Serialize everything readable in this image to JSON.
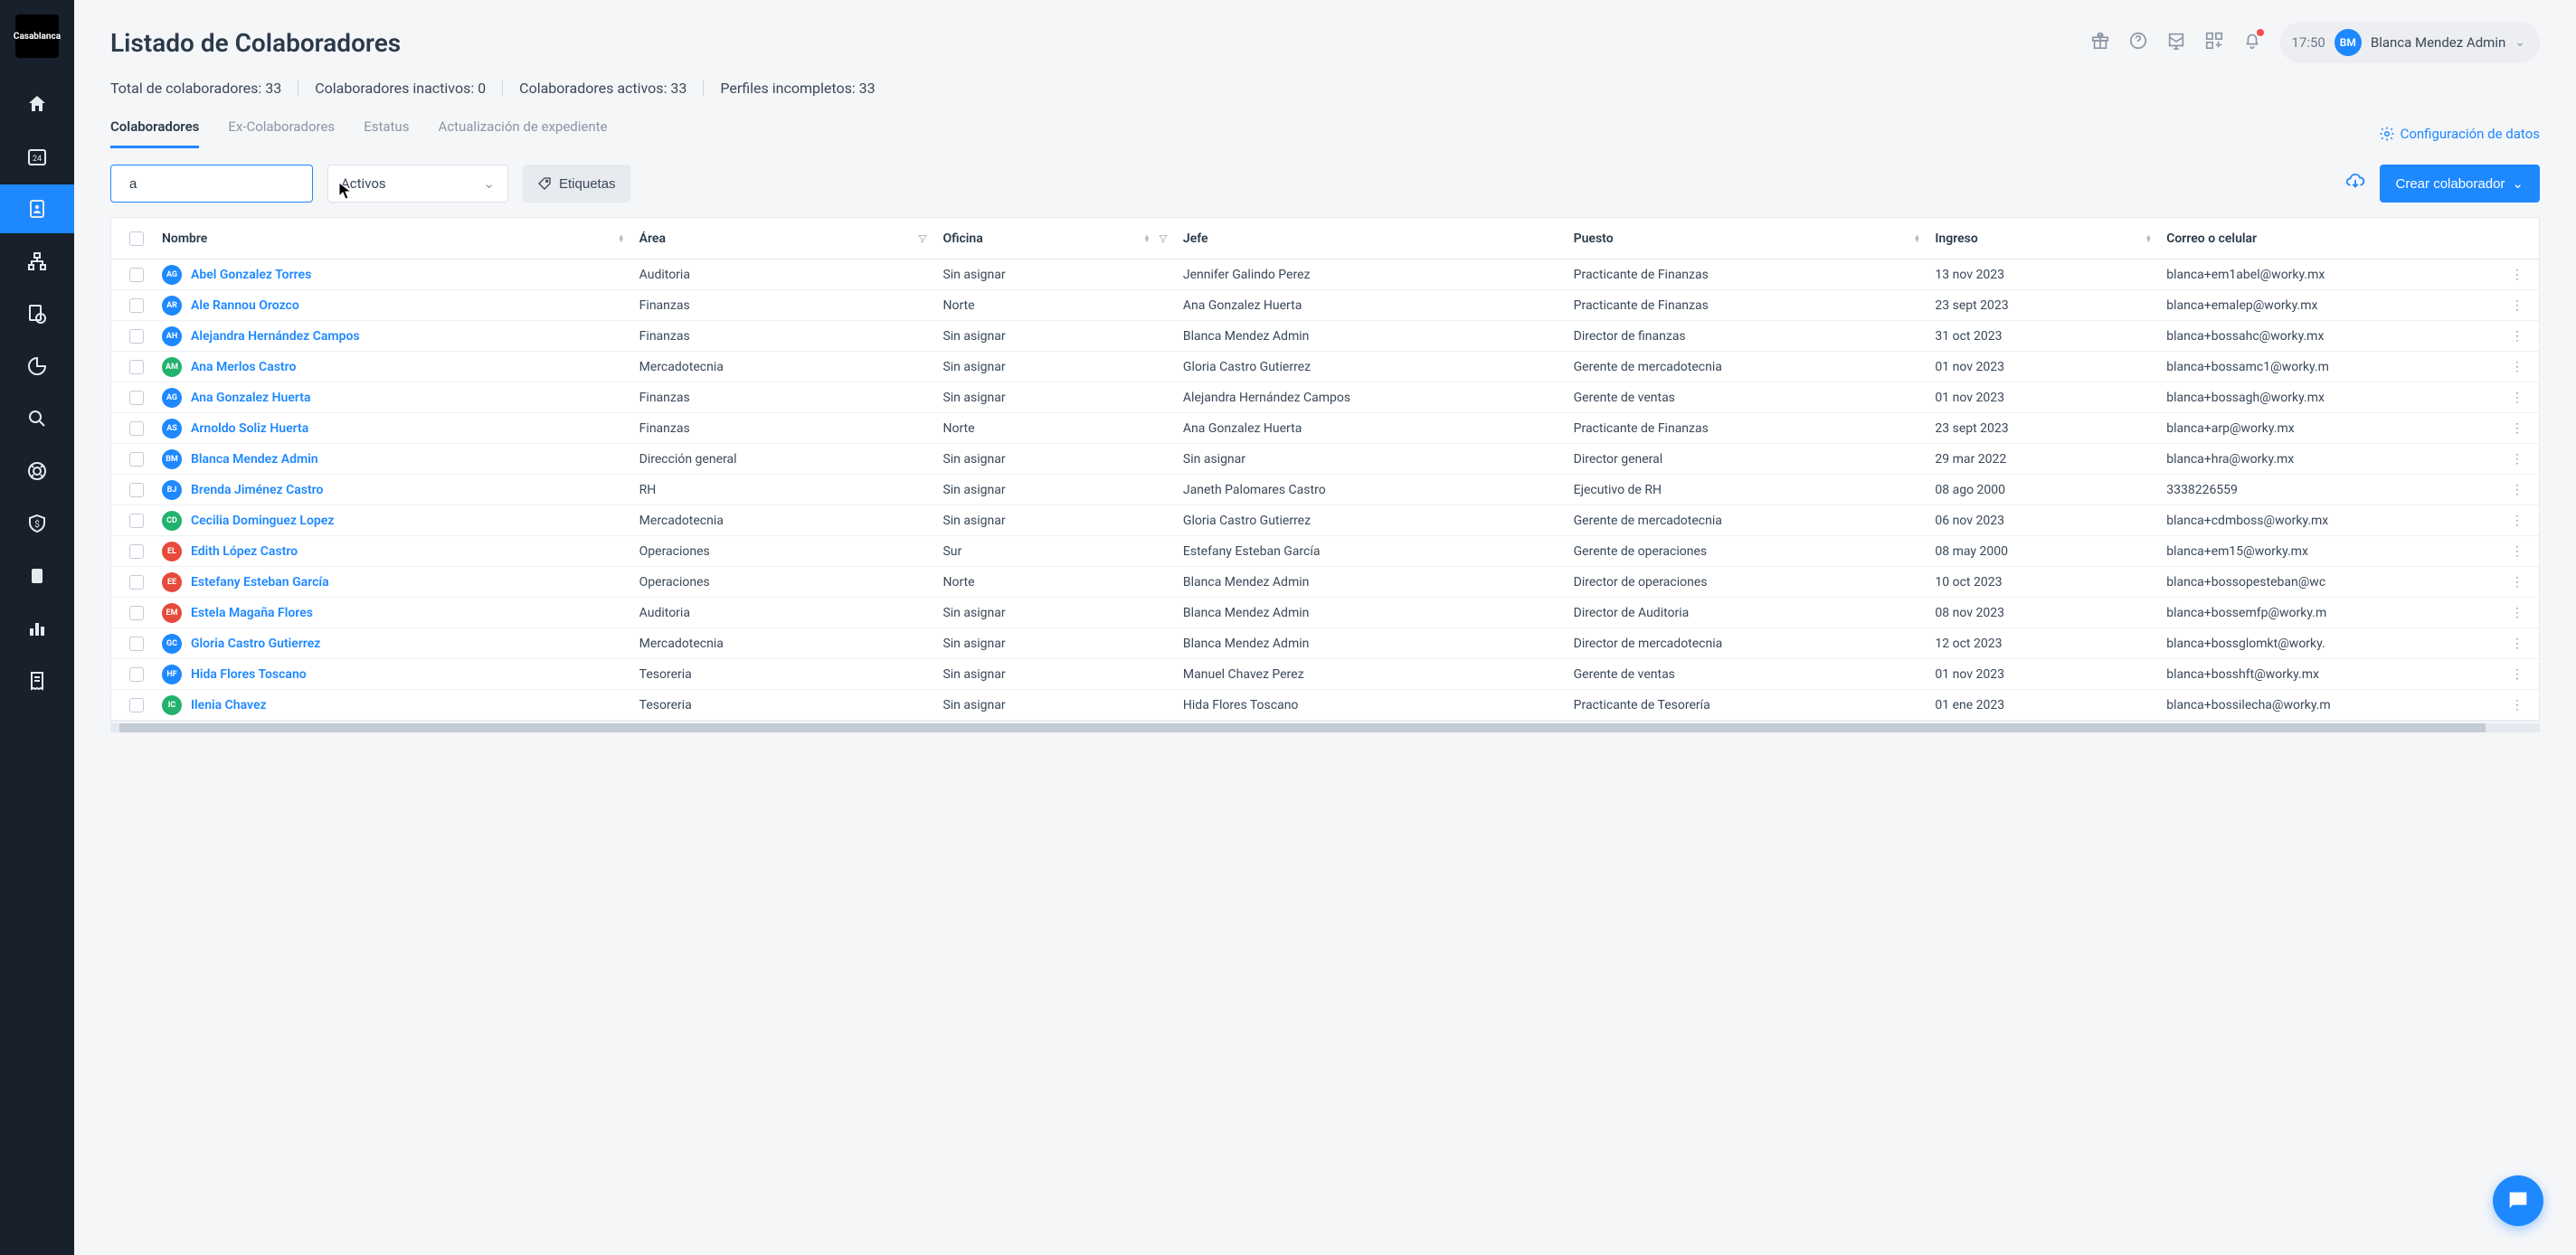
{
  "header": {
    "logo_text": "Casablanca",
    "title": "Listado de Colaboradores",
    "clock": "17:50",
    "user_initials": "BM",
    "user_name": "Blanca Mendez Admin"
  },
  "stats": {
    "total_label": "Total de colaboradores: 33",
    "inactive_label": "Colaboradores inactivos: 0",
    "active_label": "Colaboradores activos: 33",
    "incomplete_label": "Perfiles incompletos: 33"
  },
  "tabs": {
    "colaboradores": "Colaboradores",
    "ex_colaboradores": "Ex-Colaboradores",
    "estatus": "Estatus",
    "actualizacion": "Actualización de expediente",
    "config": "Configuración de datos"
  },
  "controls": {
    "search_value": "a",
    "status_filter": "Activos",
    "etiquetas": "Etiquetas",
    "crear": "Crear colaborador"
  },
  "columns": {
    "nombre": "Nombre",
    "area": "Área",
    "oficina": "Oficina",
    "jefe": "Jefe",
    "puesto": "Puesto",
    "ingreso": "Ingreso",
    "correo": "Correo o celular"
  },
  "avatar_colors": {
    "blue": "#1e88ff",
    "green": "#23b26d",
    "red": "#e64a3b"
  },
  "rows": [
    {
      "initials": "AG",
      "color": "blue",
      "nombre": "Abel Gonzalez Torres",
      "area": "Auditoria",
      "oficina": "Sin asignar",
      "jefe": "Jennifer Galindo Perez",
      "puesto": "Practicante de Finanzas",
      "ingreso": "13 nov 2023",
      "correo": "blanca+em1abel@worky.mx"
    },
    {
      "initials": "AR",
      "color": "blue",
      "nombre": "Ale Rannou Orozco",
      "area": "Finanzas",
      "oficina": "Norte",
      "jefe": "Ana Gonzalez Huerta",
      "puesto": "Practicante de Finanzas",
      "ingreso": "23 sept 2023",
      "correo": "blanca+emalep@worky.mx"
    },
    {
      "initials": "AH",
      "color": "blue",
      "nombre": "Alejandra Hernández Campos",
      "area": "Finanzas",
      "oficina": "Sin asignar",
      "jefe": "Blanca Mendez Admin",
      "puesto": "Director de finanzas",
      "ingreso": "31 oct 2023",
      "correo": "blanca+bossahc@worky.mx"
    },
    {
      "initials": "AM",
      "color": "green",
      "nombre": "Ana Merlos Castro",
      "area": "Mercadotecnia",
      "oficina": "Sin asignar",
      "jefe": "Gloria Castro Gutierrez",
      "puesto": "Gerente de mercadotecnia",
      "ingreso": "01 nov 2023",
      "correo": "blanca+bossamc1@worky.m"
    },
    {
      "initials": "AG",
      "color": "blue",
      "nombre": "Ana Gonzalez Huerta",
      "area": "Finanzas",
      "oficina": "Sin asignar",
      "jefe": "Alejandra Hernández Campos",
      "puesto": "Gerente de ventas",
      "ingreso": "01 nov 2023",
      "correo": "blanca+bossagh@worky.mx"
    },
    {
      "initials": "AS",
      "color": "blue",
      "nombre": "Arnoldo Soliz Huerta",
      "area": "Finanzas",
      "oficina": "Norte",
      "jefe": "Ana Gonzalez Huerta",
      "puesto": "Practicante de Finanzas",
      "ingreso": "23 sept 2023",
      "correo": "blanca+arp@worky.mx"
    },
    {
      "initials": "BM",
      "color": "blue",
      "nombre": "Blanca Mendez Admin",
      "area": "Dirección general",
      "oficina": "Sin asignar",
      "jefe": "Sin asignar",
      "puesto": "Director general",
      "ingreso": "29 mar 2022",
      "correo": "blanca+hra@worky.mx"
    },
    {
      "initials": "BJ",
      "color": "blue",
      "nombre": "Brenda Jiménez Castro",
      "area": "RH",
      "oficina": "Sin asignar",
      "jefe": "Janeth Palomares Castro",
      "puesto": "Ejecutivo de RH",
      "ingreso": "08 ago 2000",
      "correo": "3338226559"
    },
    {
      "initials": "CD",
      "color": "green",
      "nombre": "Cecilia Dominguez Lopez",
      "area": "Mercadotecnia",
      "oficina": "Sin asignar",
      "jefe": "Gloria Castro Gutierrez",
      "puesto": "Gerente de mercadotecnia",
      "ingreso": "06 nov 2023",
      "correo": "blanca+cdmboss@worky.mx"
    },
    {
      "initials": "EL",
      "color": "red",
      "nombre": "Edith López Castro",
      "area": "Operaciones",
      "oficina": "Sur",
      "jefe": "Estefany Esteban García",
      "puesto": "Gerente de operaciones",
      "ingreso": "08 may 2000",
      "correo": "blanca+em15@worky.mx"
    },
    {
      "initials": "EE",
      "color": "red",
      "nombre": "Estefany Esteban García",
      "area": "Operaciones",
      "oficina": "Norte",
      "jefe": "Blanca Mendez Admin",
      "puesto": "Director de operaciones",
      "ingreso": "10 oct 2023",
      "correo": "blanca+bossopesteban@wc"
    },
    {
      "initials": "EM",
      "color": "red",
      "nombre": "Estela Magaña Flores",
      "area": "Auditoria",
      "oficina": "Sin asignar",
      "jefe": "Blanca Mendez Admin",
      "puesto": "Director de Auditoria",
      "ingreso": "08 nov 2023",
      "correo": "blanca+bossemfp@worky.m"
    },
    {
      "initials": "GC",
      "color": "blue",
      "nombre": "Gloria Castro Gutierrez",
      "area": "Mercadotecnia",
      "oficina": "Sin asignar",
      "jefe": "Blanca Mendez Admin",
      "puesto": "Director de mercadotecnia",
      "ingreso": "12 oct 2023",
      "correo": "blanca+bossglomkt@worky."
    },
    {
      "initials": "HF",
      "color": "blue",
      "nombre": "Hida Flores Toscano",
      "area": "Tesoreria",
      "oficina": "Sin asignar",
      "jefe": "Manuel Chavez Perez",
      "puesto": "Gerente de ventas",
      "ingreso": "01 nov 2023",
      "correo": "blanca+bosshft@worky.mx"
    },
    {
      "initials": "IC",
      "color": "green",
      "nombre": "Ilenia Chavez",
      "area": "Tesoreria",
      "oficina": "Sin asignar",
      "jefe": "Hida Flores Toscano",
      "puesto": "Practicante de Tesorería",
      "ingreso": "01 ene 2023",
      "correo": "blanca+bossilecha@worky.m"
    }
  ]
}
